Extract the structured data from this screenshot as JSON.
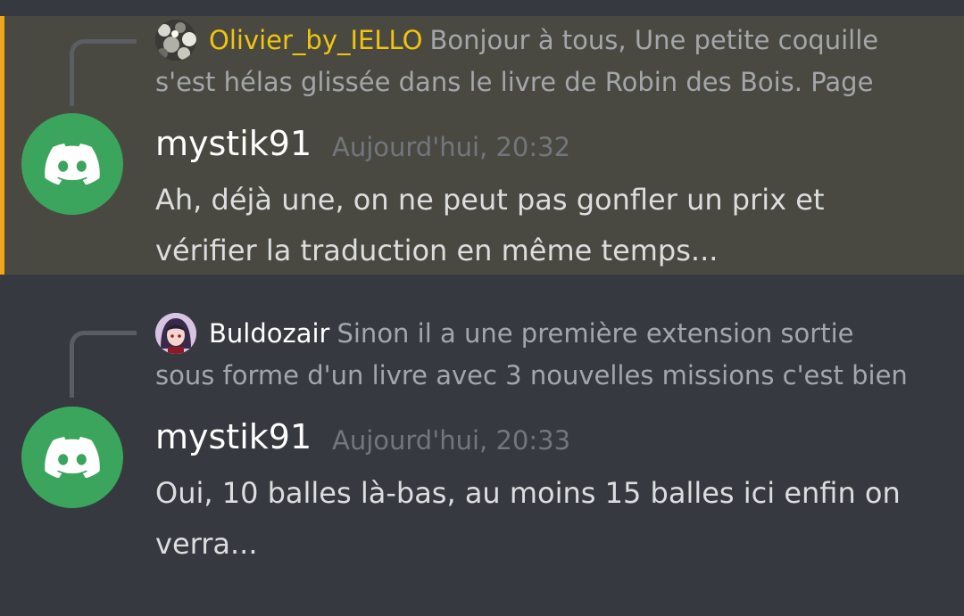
{
  "messages": [
    {
      "reply": {
        "author": "Olivier_by_IELLO",
        "author_color": "#f1c40f",
        "text_line1": "Bonjour à tous,  Une petite coquille",
        "text_line2": "s'est hélas glissée dans le livre de Robin des Bois.  Page",
        "avatar_icon": "rocky-texture-avatar"
      },
      "author": "mystik91",
      "timestamp": "Aujourd'hui, 20:32",
      "content_line1": "Ah, déjà une, on ne peut pas gonfler un prix et",
      "content_line2": "vérifier la traduction en même temps...",
      "avatar_icon": "discord-icon",
      "highlighted": true,
      "highlight_color": "#f0a616"
    },
    {
      "reply": {
        "author": "Buldozair",
        "author_color": "#ffffff",
        "text_line1": "Sinon il  a une première extension sortie",
        "text_line2": "sous forme d'un livre avec 3 nouvelles missions c'est bien",
        "avatar_icon": "anime-character-avatar"
      },
      "author": "mystik91",
      "timestamp": "Aujourd'hui, 20:33",
      "content_line1": "Oui, 10 balles là-bas, au moins 15 balles ici enfin on",
      "content_line2": "verra...",
      "avatar_icon": "discord-icon",
      "highlighted": false
    }
  ],
  "colors": {
    "background": "#36393f",
    "highlight_background": "#4a4941",
    "avatar_green": "#3ba55d",
    "timestamp": "#72767d",
    "message_text": "#dcddde",
    "reply_text": "#a3a6aa"
  }
}
